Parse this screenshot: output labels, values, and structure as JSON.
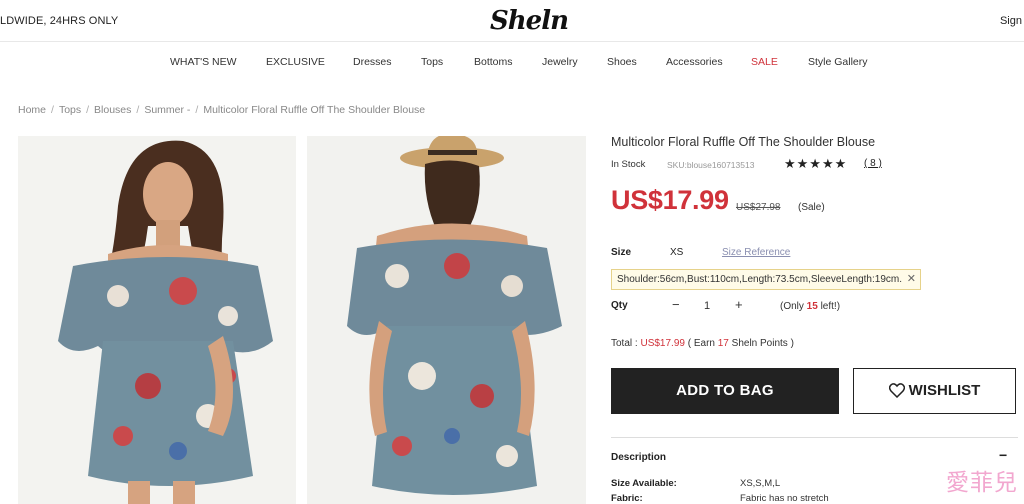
{
  "header": {
    "promo": "LDWIDE, 24HRS ONLY",
    "logo": "Sheln",
    "signin": "Sign"
  },
  "nav": {
    "items": [
      "WHAT'S NEW",
      "EXCLUSIVE",
      "Dresses",
      "Tops",
      "Bottoms",
      "Jewelry",
      "Shoes",
      "Accessories",
      "SALE",
      "Style Gallery"
    ]
  },
  "breadcrumb": [
    "Home",
    "Tops",
    "Blouses",
    "Summer -",
    "Multicolor Floral Ruffle Off The Shoulder Blouse"
  ],
  "product": {
    "title": "Multicolor Floral Ruffle Off The Shoulder Blouse",
    "stock": "In Stock",
    "sku": "SKU:blouse160713513",
    "stars": "★★★★★",
    "reviews": "( 8 )",
    "price": "US$17.99",
    "old_price": "US$27.98",
    "sale_tag": "(Sale)",
    "size_label": "Size",
    "size_value": "XS",
    "size_reference": "Size Reference",
    "measurements": "Shoulder:56cm,Bust:110cm,Length:73.5cm,SleeveLength:19cm.",
    "qty_label": "Qty",
    "qty_minus": "−",
    "qty_value": "1",
    "qty_plus": "+",
    "only_prefix": "(Only ",
    "only_count": "15",
    "only_suffix": " left!)",
    "total_prefix": "Total : ",
    "total_price": "US$17.99",
    "earn_prefix": " ( Earn ",
    "earn_points": "17",
    "earn_suffix": " Sheln Points )",
    "add_to_bag": "ADD TO BAG",
    "wishlist": "WISHLIST",
    "description_label": "Description",
    "description_toggle": "−",
    "specs": [
      {
        "key": "Size Available:",
        "value": "XS,S,M,L"
      },
      {
        "key": "Fabric:",
        "value": "Fabric has no stretch"
      }
    ]
  },
  "watermark": "愛菲兒",
  "colors": {
    "accent_red": "#d0323a",
    "button_dark": "#222222"
  },
  "icons": {
    "wishlist": "heart-icon",
    "close": "close-icon"
  }
}
